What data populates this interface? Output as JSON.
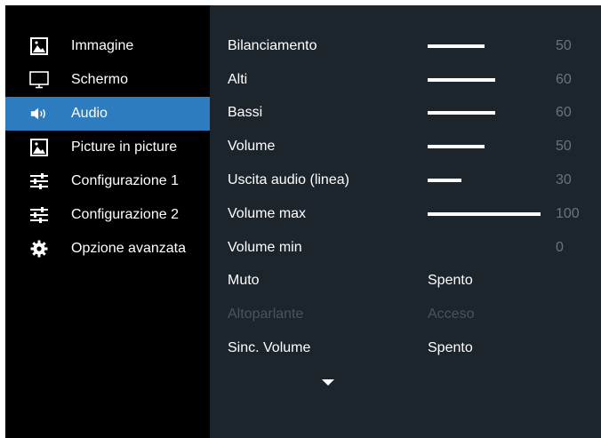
{
  "sidebar": {
    "items": [
      {
        "label": "Immagine",
        "icon": "picture-icon"
      },
      {
        "label": "Schermo",
        "icon": "monitor-icon"
      },
      {
        "label": "Audio",
        "icon": "speaker-icon",
        "active": true
      },
      {
        "label": "Picture in picture",
        "icon": "picture-icon"
      },
      {
        "label": "Configurazione 1",
        "icon": "sliders-icon"
      },
      {
        "label": "Configurazione 2",
        "icon": "sliders-icon"
      },
      {
        "label": "Opzione avanzata",
        "icon": "gear-icon"
      }
    ]
  },
  "audio_settings": {
    "rows": [
      {
        "label": "Bilanciamento",
        "value": "50",
        "level": 50
      },
      {
        "label": "Alti",
        "value": "60",
        "level": 60
      },
      {
        "label": "Bassi",
        "value": "60",
        "level": 60
      },
      {
        "label": "Volume",
        "value": "50",
        "level": 50
      },
      {
        "label": "Uscita audio (linea)",
        "value": "30",
        "level": 30
      },
      {
        "label": "Volume max",
        "value": "100",
        "level": 100
      },
      {
        "label": "Volume min",
        "value": "0",
        "level": 0
      },
      {
        "label": "Muto",
        "text_value": "Spento"
      },
      {
        "label": "Altoparlante",
        "text_value": "Acceso",
        "disabled": true
      },
      {
        "label": "Sinc. Volume",
        "text_value": "Spento"
      }
    ]
  },
  "colors": {
    "sidebar_bg": "#000000",
    "main_bg": "#1d252c",
    "active_bg": "#2e7cc0",
    "number_text": "#6a737a",
    "disabled_text": "#4a535b"
  }
}
